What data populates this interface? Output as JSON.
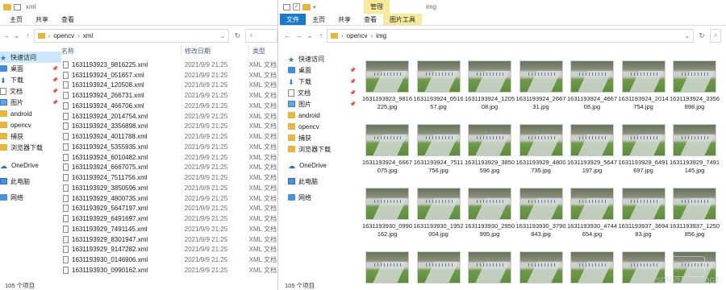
{
  "left": {
    "title": "xml",
    "ribbon_tabs": [
      "主页",
      "共享",
      "查看"
    ],
    "path": [
      "opencv",
      "xml"
    ],
    "columns": {
      "name": "名称",
      "date": "修改日期",
      "type": "类型"
    },
    "nav": [
      {
        "label": "快速访问",
        "icon": "star-icon",
        "selected": true
      },
      {
        "label": "桌面",
        "icon": "desktop-icon",
        "pinned": true
      },
      {
        "label": "下载",
        "icon": "download-icon",
        "pinned": true
      },
      {
        "label": "文档",
        "icon": "document-icon",
        "pinned": true
      },
      {
        "label": "图片",
        "icon": "pictures-icon",
        "pinned": true
      },
      {
        "label": "android",
        "icon": "folder-icon"
      },
      {
        "label": "opencv",
        "icon": "folder-icon"
      },
      {
        "label": "捕获",
        "icon": "folder-icon"
      },
      {
        "label": "浏览器下载",
        "icon": "folder-icon"
      },
      {
        "label": "OneDrive",
        "icon": "cloud-icon"
      },
      {
        "label": "此电脑",
        "icon": "pc-icon"
      },
      {
        "label": "网络",
        "icon": "network-icon"
      }
    ],
    "files": [
      {
        "name": "1631193923_9816225.xml",
        "date": "2021/9/9 21:25",
        "type": "XML 文档"
      },
      {
        "name": "1631193924_051657.xml",
        "date": "2021/9/9 21:25",
        "type": "XML 文档"
      },
      {
        "name": "1631193924_120508.xml",
        "date": "2021/9/9 21:25",
        "type": "XML 文档"
      },
      {
        "name": "1631193924_266731.xml",
        "date": "2021/9/9 21:25",
        "type": "XML 文档"
      },
      {
        "name": "1631193924_466706.xml",
        "date": "2021/9/9 21:25",
        "type": "XML 文档"
      },
      {
        "name": "1631193924_2014754.xml",
        "date": "2021/9/9 21:25",
        "type": "XML 文档"
      },
      {
        "name": "1631193924_3356898.xml",
        "date": "2021/9/9 21:25",
        "type": "XML 文档"
      },
      {
        "name": "1631193924_4011788.xml",
        "date": "2021/9/9 21:25",
        "type": "XML 文档"
      },
      {
        "name": "1631193924_5355935.xml",
        "date": "2021/9/9 21:25",
        "type": "XML 文档"
      },
      {
        "name": "1631193924_6010482.xml",
        "date": "2021/9/9 21:25",
        "type": "XML 文档"
      },
      {
        "name": "1631193924_6667075.xml",
        "date": "2021/9/9 21:25",
        "type": "XML 文档"
      },
      {
        "name": "1631193924_7511756.xml",
        "date": "2021/9/9 21:25",
        "type": "XML 文档"
      },
      {
        "name": "1631193929_3850596.xml",
        "date": "2021/9/9 21:25",
        "type": "XML 文档"
      },
      {
        "name": "1631193929_4800735.xml",
        "date": "2021/9/9 21:25",
        "type": "XML 文档"
      },
      {
        "name": "1631193929_5647197.xml",
        "date": "2021/9/9 21:25",
        "type": "XML 文档"
      },
      {
        "name": "1631193929_6491697.xml",
        "date": "2021/9/9 21:25",
        "type": "XML 文档"
      },
      {
        "name": "1631193929_7491145.xml",
        "date": "2021/9/9 21:25",
        "type": "XML 文档"
      },
      {
        "name": "1631193929_8301947.xml",
        "date": "2021/9/9 21:25",
        "type": "XML 文档"
      },
      {
        "name": "1631193929_9147282.xml",
        "date": "2021/9/9 21:25",
        "type": "XML 文档"
      },
      {
        "name": "1631193930_0146906.xml",
        "date": "2021/9/9 21:25",
        "type": "XML 文档"
      },
      {
        "name": "1631193930_0990162.xml",
        "date": "2021/9/9 21:25",
        "type": "XML 文档"
      }
    ],
    "status": "105 个项目"
  },
  "right": {
    "context_tab": "管理",
    "title": "img",
    "ribbon_tabs": [
      "文件",
      "主页",
      "共享",
      "查看",
      "图片工具"
    ],
    "path": [
      "opencv",
      "img"
    ],
    "nav": [
      {
        "label": "快速访问",
        "icon": "star-icon"
      },
      {
        "label": "桌面",
        "icon": "desktop-icon",
        "pinned": true
      },
      {
        "label": "下载",
        "icon": "download-icon",
        "pinned": true
      },
      {
        "label": "文档",
        "icon": "document-icon",
        "pinned": true
      },
      {
        "label": "图片",
        "icon": "pictures-icon",
        "pinned": true
      },
      {
        "label": "android",
        "icon": "folder-icon"
      },
      {
        "label": "opencv",
        "icon": "folder-icon"
      },
      {
        "label": "捕获",
        "icon": "folder-icon"
      },
      {
        "label": "浏览器下载",
        "icon": "folder-icon"
      },
      {
        "label": "OneDrive",
        "icon": "cloud-icon"
      },
      {
        "label": "此电脑",
        "icon": "pc-icon"
      },
      {
        "label": "网络",
        "icon": "network-icon"
      }
    ],
    "thumbs": [
      "1631193923_9816225.jpg",
      "1631193924_051657.jpg",
      "1631193924_120508.jpg",
      "1631193924_266731.jpg",
      "1631193924_466706.jpg",
      "1631193924_2014754.jpg",
      "1631193924_3356898.jpg",
      "1631193924_6667075.jpg",
      "1631193924_7511756.jpg",
      "1631193929_3850596.jpg",
      "1631193929_4800735.jpg",
      "1631193929_5647197.jpg",
      "1631193929_6491697.jpg",
      "1631193929_7491145.jpg",
      "1631193930_0990162.jpg",
      "1631193930_1952004.jpg",
      "1631193930_2950995.jpg",
      "1631193930_3790843.jpg",
      "1631193930_4744654.jpg",
      "1631193937_369483.jpg",
      "1631193937_1250856.jpg",
      "",
      "",
      "",
      "",
      "",
      "",
      ""
    ],
    "status": "105 个项目"
  },
  "watermark": "CSDN @巴比伦 BGT"
}
